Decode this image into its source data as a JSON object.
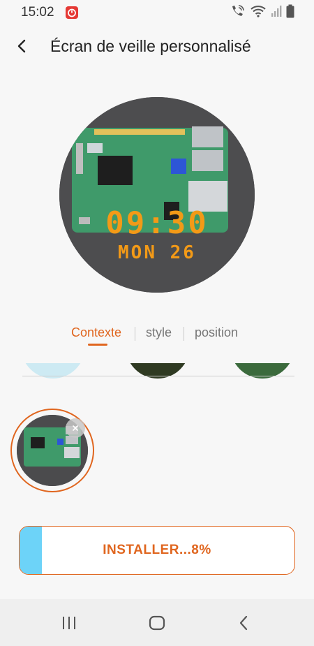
{
  "status_bar": {
    "time": "15:02",
    "icons": [
      "app-notification-icon",
      "wifi-call-icon",
      "wifi-icon",
      "signal-icon",
      "battery-icon"
    ]
  },
  "header": {
    "back_icon": "back-arrow-icon",
    "title": "Écran de veille personnalisé"
  },
  "preview": {
    "time": "09:30",
    "date": "MON 26",
    "clock_color": "#f39a17"
  },
  "tabs": [
    {
      "label": "Contexte",
      "active": true
    },
    {
      "label": "style",
      "active": false
    },
    {
      "label": "position",
      "active": false
    }
  ],
  "install": {
    "label": "INSTALLER...8%",
    "progress": 0.08,
    "fill_color": "#6dd3f8"
  },
  "colors": {
    "accent": "#e0661f",
    "background": "#f7f7f7"
  },
  "nav_bar": {
    "icons": [
      "recent-apps-icon",
      "home-icon",
      "back-icon"
    ]
  }
}
